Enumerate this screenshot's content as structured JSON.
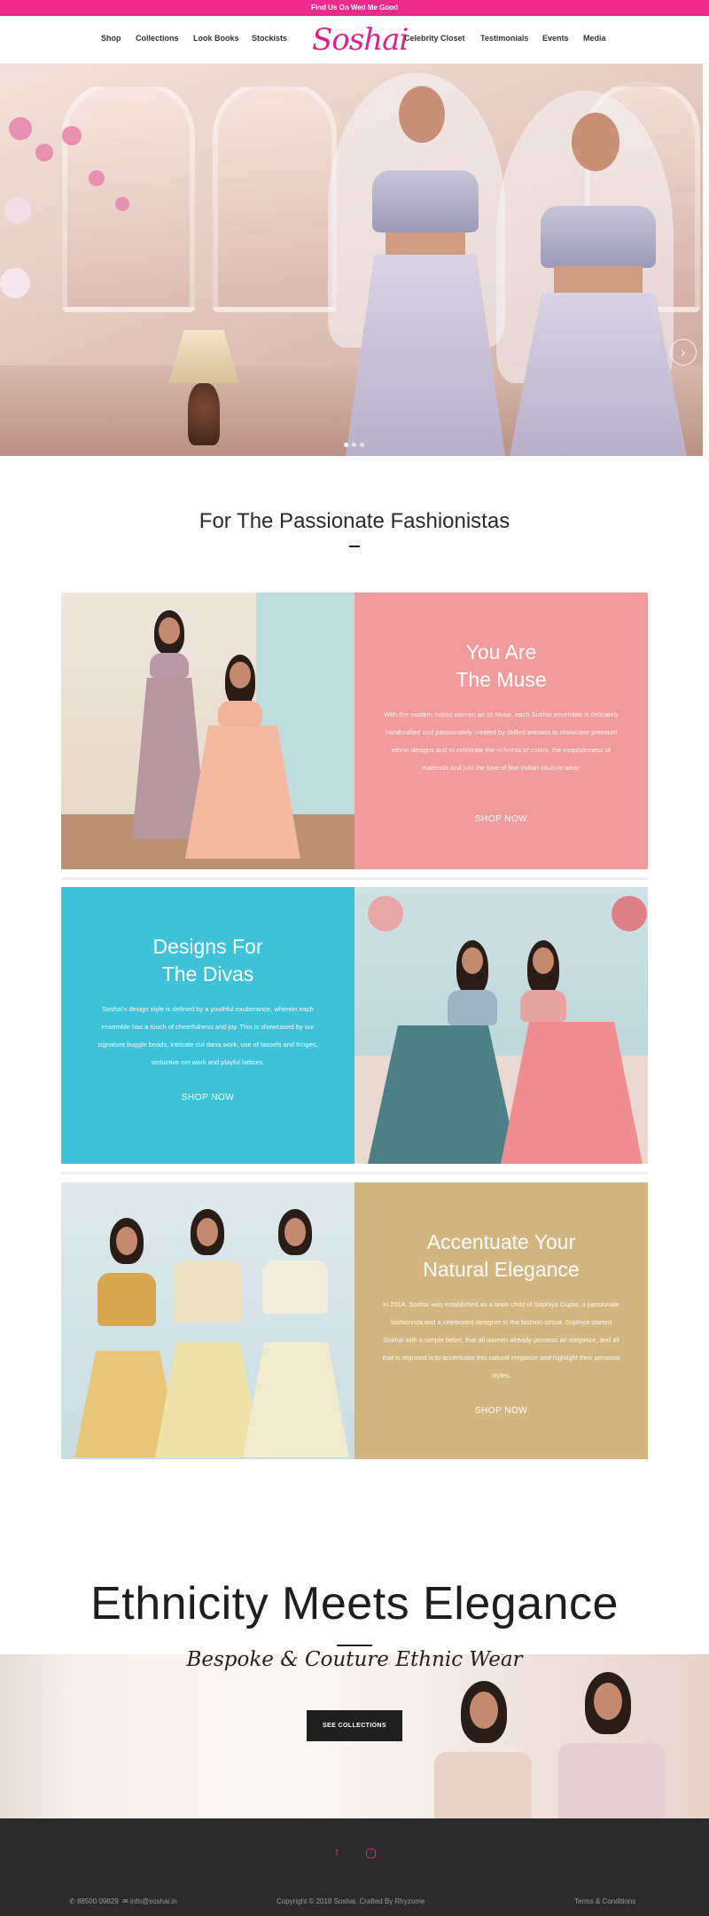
{
  "announcement": "Find Us On Wed Me Good",
  "brand": {
    "logo_text": "Soshai",
    "accent_color": "#ee2a8d"
  },
  "nav": {
    "left": [
      "Shop",
      "Collections",
      "Look Books",
      "Stockists"
    ],
    "right": [
      "Celebrity Closet",
      "Testimonials",
      "Events",
      "Media"
    ]
  },
  "hero": {
    "slides": 3,
    "active_slide": 1,
    "next_icon": "chevron-right-icon"
  },
  "intro": {
    "title": "For The Passionate Fashionistas"
  },
  "features": [
    {
      "heading_line1": "You Are",
      "heading_line2": "The Muse",
      "body": "With the modern Indian women as its Muse, each Soshai ensemble is delicately handcrafted and passionately created by skilled artisans to showcase premium ethnic designs and to celebrate the richness of colors, the exquisiteness of materials and just the love of fine Indian couture wear.",
      "button": "SHOP NOW",
      "color": "#f29b9c"
    },
    {
      "heading_line1": "Designs For",
      "heading_line2": "The Divas",
      "body": "Soshai's design style is defined by a youthful exuberance, wherein each ensemble has a touch of cheerfulness and joy. This is showcased by our signature buggle beads, intricate cut dana work, use of tassels and fringes, seductive net work and playful lattices.",
      "button": "SHOP NOW",
      "color": "#3ec2da"
    },
    {
      "heading_line1": "Accentuate Your",
      "heading_line2": "Natural Elegance",
      "body": "In 2014, Soshai was established as a brain child of Sophiya Gupta, a passionate fashionista and a celebrated designer in the fashion circuit. Sophiya started Soshai with a simple belief, that all women already possess an elegance, and all that is required is to accentuate this natural elegance and highlight their personal styles.",
      "button": "SHOP NOW",
      "color": "#d2b57f"
    }
  ],
  "tagline": {
    "title": "Ethnicity Meets Elegance",
    "script": "Bespoke & Couture Ethnic Wear",
    "button": "SEE COLLECTIONS"
  },
  "footer": {
    "social": [
      "facebook-icon",
      "instagram-icon"
    ],
    "phone": "88500 09829",
    "email": "info@soshai.in",
    "copyright": "Copyright © 2018 Soshai. Crafted By Rhyzome",
    "terms": "Terms & Conditions"
  }
}
